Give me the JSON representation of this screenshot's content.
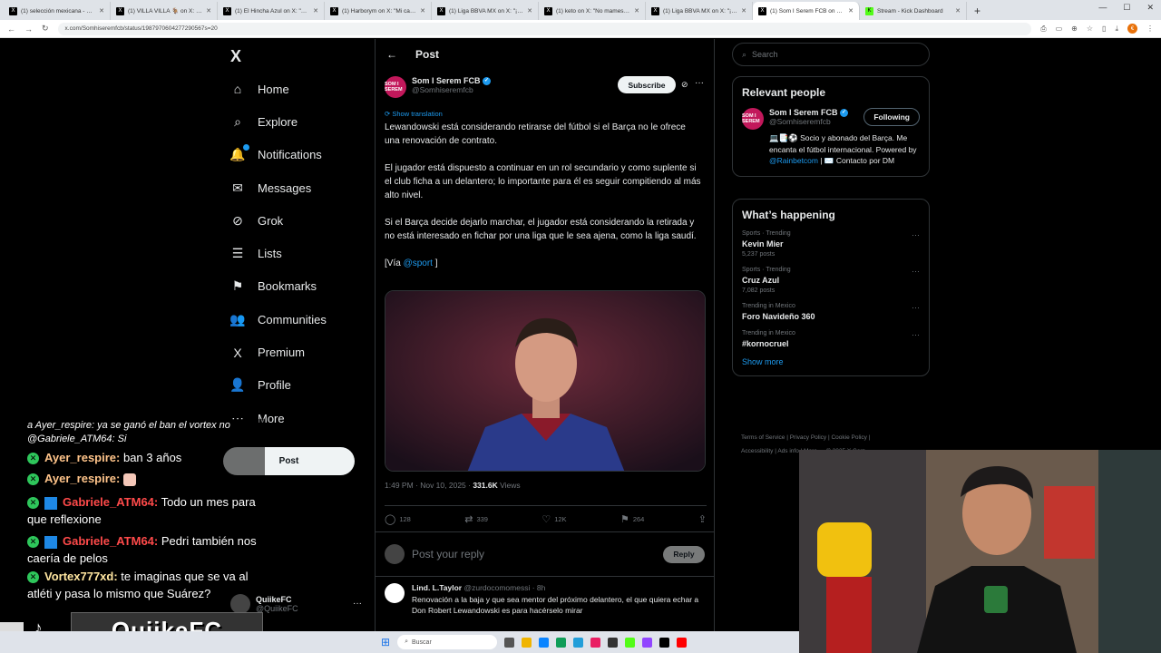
{
  "browser": {
    "tabs": [
      {
        "label": "(1) selección mexicana - Search",
        "icon": "X",
        "active": false
      },
      {
        "label": "(1) VILLA VILLA 🐐 on X: \"Agua",
        "icon": "X",
        "active": false
      },
      {
        "label": "(1) El Hincha Azul on X: \"Voy a",
        "icon": "X",
        "active": false
      },
      {
        "label": "(1) Harborym on X: \"Mi campe",
        "icon": "X",
        "active": false
      },
      {
        "label": "(1) Liga BBVA MX on X: \"¡Así se",
        "icon": "X",
        "active": false
      },
      {
        "label": "(1) keto on X: \"No mames se m",
        "icon": "X",
        "active": false
      },
      {
        "label": "(1) Liga BBVA MX on X: \"¡Los m",
        "icon": "X",
        "active": false
      },
      {
        "label": "(1) Som I Serem FCB on X: \"Lew",
        "icon": "X",
        "active": true
      },
      {
        "label": "Stream - Kick Dashboard",
        "icon": "K",
        "active": false
      }
    ],
    "url": "x.com/Somhiseremfcb/status/1987970604277290567s=20"
  },
  "sidebar": {
    "logo": "X",
    "items": [
      {
        "label": "Home",
        "icon": "⌂"
      },
      {
        "label": "Explore",
        "icon": "⌕"
      },
      {
        "label": "Notifications",
        "icon": "🔔"
      },
      {
        "label": "Messages",
        "icon": "✉"
      },
      {
        "label": "Grok",
        "icon": "⊘"
      },
      {
        "label": "Lists",
        "icon": "☰"
      },
      {
        "label": "Bookmarks",
        "icon": "⚑"
      },
      {
        "label": "Communities",
        "icon": "👥"
      },
      {
        "label": "Premium",
        "icon": "X"
      },
      {
        "label": "Profile",
        "icon": "👤"
      },
      {
        "label": "More",
        "icon": "⋯"
      }
    ],
    "post_button": "Post",
    "account": {
      "name": "QuiikeFC",
      "handle": "@QuiikeFC"
    }
  },
  "main": {
    "header_title": "Post",
    "author": {
      "name": "Som I Serem FCB",
      "handle": "@Somhiseremfcb",
      "avatar_text": "SOM I SEREM"
    },
    "subscribe_label": "Subscribe",
    "translate_label": "Show translation",
    "paragraphs": [
      "Lewandowski está considerando retirarse del fútbol si el Barça no le ofrece una renovación de contrato.",
      "El jugador está dispuesto a continuar en un rol secundario y como suplente si el club ficha a un delantero; lo importante para él es seguir compitiendo al más alto nivel.",
      "Si el Barça decide dejarlo marchar, el jugador está considerando la retirada y no está interesado en fichar por una liga que le sea ajena, como la liga saudí."
    ],
    "via_prefix": "[Vía ",
    "via_link": "@sport",
    "via_suffix": " ]",
    "meta_time": "1:49 PM · Nov 10, 2025 · ",
    "meta_views_count": "331.6K",
    "meta_views_label": " Views",
    "actions": {
      "replies": "128",
      "reposts": "339",
      "likes": "12K",
      "bookmarks": "264"
    },
    "reply_placeholder": "Post your reply",
    "reply_button": "Reply",
    "reply": {
      "name": "Lind. L.Taylor",
      "handle": "@zurdocomomessi · 8h",
      "text": "Renovación a la baja y que sea mentor del próximo delantero, el que quiera echar a Don Robert Lewandowski es para hacérselo mirar"
    }
  },
  "right": {
    "search_placeholder": "Search",
    "relevant_title": "Relevant people",
    "person": {
      "name": "Som I Serem FCB",
      "handle": "@Somhiseremfcb",
      "follow_label": "Following",
      "bio_1": "💻📑⚽ Socio y abonado del Barça. Me encanta el fútbol internacional. Powered by ",
      "bio_link": "@Rainbetcom",
      "bio_2": " | ✉️ Contacto por DM"
    },
    "happening_title": "What’s happening",
    "trends": [
      {
        "category": "Sports · Trending",
        "name": "Kevin Mier",
        "count": "5,237 posts"
      },
      {
        "category": "Sports · Trending",
        "name": "Cruz Azul",
        "count": "7,082 posts"
      },
      {
        "category": "Trending in Mexico",
        "name": "Foro Navideño 360",
        "count": ""
      },
      {
        "category": "Trending in Mexico",
        "name": "#kornocruel",
        "count": ""
      }
    ],
    "show_more": "Show more",
    "footer_1": "Terms of Service  |  Privacy Policy  |  Cookie Policy  |",
    "footer_2": "Accessibility  |  Ads info  |  More ···  © 2025 X Corp."
  },
  "stream": {
    "chat": [
      {
        "user": "",
        "text": "a Ayer_respire: ya se ganó el ban el vortex no @Gabriele_ATM64: Si",
        "style": "italic"
      },
      {
        "user": "Ayer_respire:",
        "text": " ban 3 años",
        "style": "normal"
      },
      {
        "user": "Ayer_respire:",
        "text": "",
        "style": "emote"
      },
      {
        "user": "Gabriele_ATM64:",
        "text": " Todo un mes para que reflexione",
        "style": "red"
      },
      {
        "user": "Gabriele_ATM64:",
        "text": " Pedri también nos caería de pelos",
        "style": "red"
      },
      {
        "user": "Vortex777xd:",
        "text": " te imaginas que se va al atléti y pasa lo mismo que Suárez?",
        "style": "normal"
      }
    ],
    "banner": "QuiikeFC"
  },
  "taskbar": {
    "search": "Buscar"
  }
}
